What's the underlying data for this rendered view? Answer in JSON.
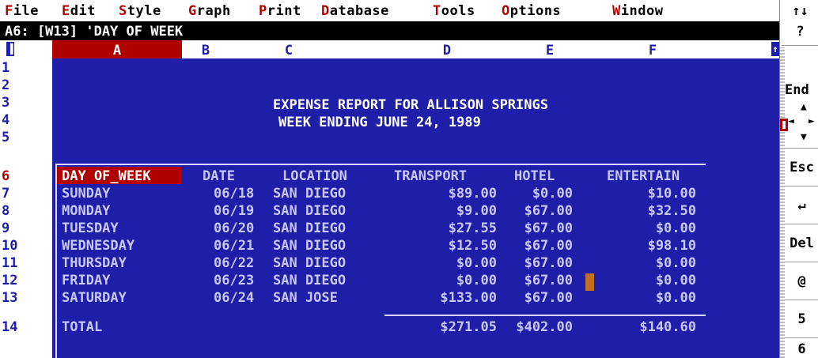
{
  "menu": {
    "items": [
      {
        "hotkey": "F",
        "rest": "ile"
      },
      {
        "hotkey": "E",
        "rest": "dit"
      },
      {
        "hotkey": "S",
        "rest": "tyle"
      },
      {
        "hotkey": "G",
        "rest": "raph"
      },
      {
        "hotkey": "P",
        "rest": "rint"
      },
      {
        "hotkey": "D",
        "rest": "atabase"
      },
      {
        "hotkey": "T",
        "rest": "ools"
      },
      {
        "hotkey": "O",
        "rest": "ptions"
      },
      {
        "hotkey": "W",
        "rest": "indow"
      }
    ]
  },
  "cell_indicator": "A6: [W13] 'DAY OF WEEK",
  "columns": [
    "A",
    "B",
    "C",
    "D",
    "E",
    "F"
  ],
  "rows": [
    "1",
    "2",
    "3",
    "4",
    "5",
    "6",
    "7",
    "8",
    "9",
    "10",
    "11",
    "12",
    "13",
    "14"
  ],
  "report": {
    "title": "EXPENSE REPORT FOR ALLISON SPRINGS",
    "subtitle": "WEEK ENDING JUNE 24, 1989"
  },
  "table": {
    "headers": [
      "DAY OF_WEEK",
      "DATE",
      "LOCATION",
      "TRANSPORT",
      "HOTEL",
      "ENTERTAIN"
    ],
    "rows": [
      [
        "SUNDAY",
        "06/18",
        "SAN DIEGO",
        "$89.00",
        "$0.00",
        "$10.00"
      ],
      [
        "MONDAY",
        "06/19",
        "SAN DIEGO",
        "$9.00",
        "$67.00",
        "$32.50"
      ],
      [
        "TUESDAY",
        "06/20",
        "SAN DIEGO",
        "$27.55",
        "$67.00",
        "$0.00"
      ],
      [
        "WEDNESDAY",
        "06/21",
        "SAN DIEGO",
        "$12.50",
        "$67.00",
        "$98.10"
      ],
      [
        "THURSDAY",
        "06/22",
        "SAN DIEGO",
        "$0.00",
        "$67.00",
        "$0.00"
      ],
      [
        "FRIDAY",
        "06/23",
        "SAN DIEGO",
        "$0.00",
        "$67.00",
        "$0.00"
      ],
      [
        "SATURDAY",
        "06/24",
        "SAN JOSE",
        "$133.00",
        "$67.00",
        "$0.00"
      ]
    ],
    "total": {
      "label": "TOTAL",
      "transport": "$271.05",
      "hotel": "$402.00",
      "entertain": "$140.60"
    }
  },
  "rightbar": {
    "scroll_toggle": "↑↓",
    "help": "?",
    "end": "End",
    "esc": "Esc",
    "enter": "↵",
    "del": "Del",
    "at": "@",
    "five": "5",
    "six": "6"
  },
  "colors": {
    "sheet_bg": "#1e1ea8",
    "hotkey": "#b00000",
    "selection": "#b00000"
  }
}
